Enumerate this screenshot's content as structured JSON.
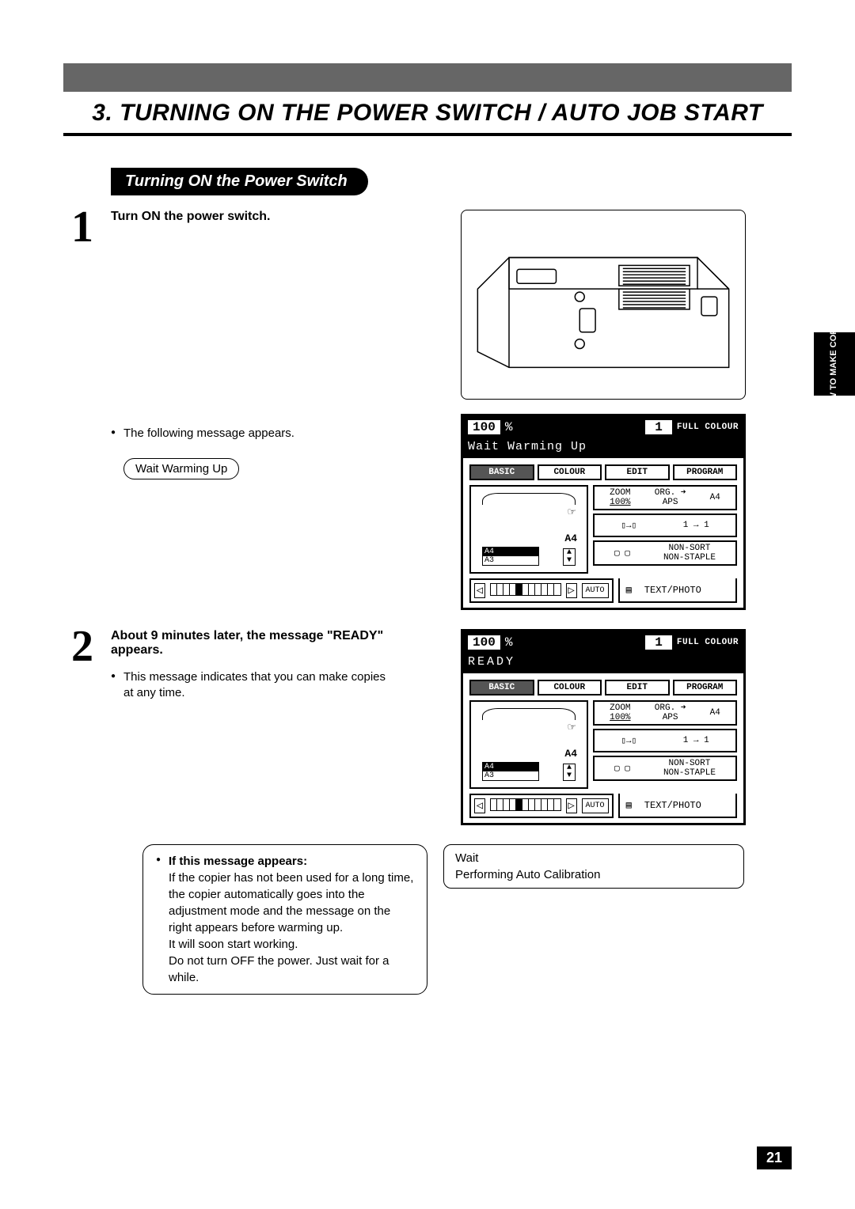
{
  "chapter": {
    "number": "3.",
    "title": "TURNING ON THE POWER SWITCH / AUTO JOB START"
  },
  "section_title": "Turning ON the Power Switch",
  "side_tab": "HOW TO\nMAKE\nCOPIES",
  "steps": {
    "s1": {
      "num": "1",
      "heading": "Turn ON the power switch.",
      "bullet": "The following message appears.",
      "bubble": "Wait Warming Up"
    },
    "s2": {
      "num": "2",
      "heading": "About 9 minutes later, the message \"READY\" appears.",
      "bullet": "This message indicates that you can make copies at any time."
    }
  },
  "display": {
    "percent_value": "100",
    "percent_sign": "%",
    "count": "1",
    "full_colour": "FULL COLOUR",
    "msg_warming": "Wait Warming Up",
    "msg_ready": "READY",
    "tabs": {
      "basic": "BASIC",
      "colour": "COLOUR",
      "edit": "EDIT",
      "program": "PROGRAM"
    },
    "zoom_label": "ZOOM",
    "zoom_value": "100%",
    "org_label": "ORG. ➜",
    "aps": "APS",
    "a4": "A4",
    "a3": "A3",
    "one_to_one": "1 → 1",
    "nonsort": "NON-SORT",
    "nonstaple": "NON-STAPLE",
    "auto": "AUTO",
    "textphoto": "TEXT/PHOTO"
  },
  "note": {
    "heading": "If this message appears:",
    "body1": "If the copier has not been used for a long time, the copier automatically goes into the adjustment mode and the message on the right appears before warming up.",
    "body2": "It will soon start working.",
    "body3": "Do not turn OFF the power. Just wait for a while."
  },
  "wait_box": {
    "l1": "Wait",
    "l2": "Performing Auto Calibration"
  },
  "page_number": "21"
}
